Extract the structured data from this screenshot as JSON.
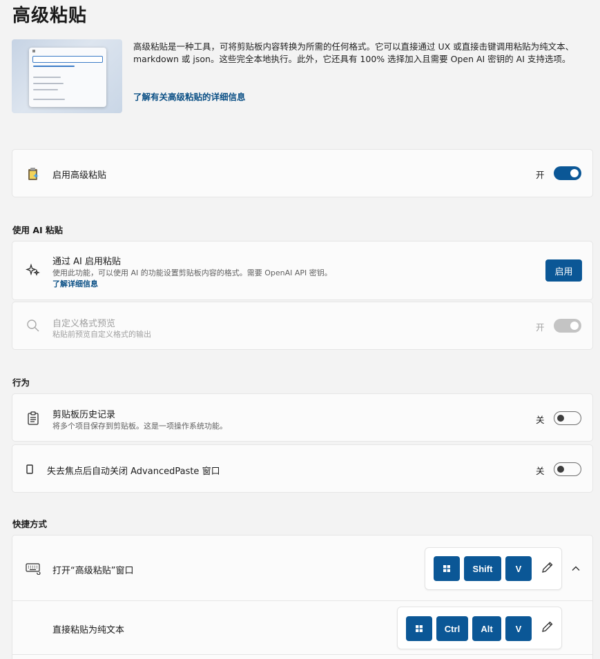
{
  "page": {
    "title": "高级粘贴",
    "description": "高级粘贴是一种工具，可将剪贴板内容转换为所需的任何格式。它可以直接通过 UX 或直接击键调用粘贴为纯文本、markdown 或 json。这些完全本地执行。此外，它还具有 100% 选择加入且需要 Open AI 密钥的 AI 支持选项。",
    "learn_more_link": "了解有关高级粘贴的详细信息"
  },
  "hero_mock": {
    "search_placeholder": "Describe a format (e.g. using AI)",
    "items": [
      "Paste as plain text",
      "Paste as markdown",
      "Paste as JSON",
      "Clipboard history"
    ]
  },
  "enable_card": {
    "icon": "advanced-paste-app-icon",
    "title": "启用高级粘贴",
    "state_label": "开",
    "enabled": true
  },
  "ai_section": {
    "header": "使用 AI 粘贴",
    "ai_paste": {
      "icon": "sparkle-icon",
      "title": "通过 AI 启用粘贴",
      "description": "使用此功能，可以使用 AI 的功能设置剪贴板内容的格式。需要 OpenAI API 密钥。",
      "link": "了解详细信息",
      "button": "启用"
    },
    "custom_preview": {
      "icon": "search-icon",
      "title": "自定义格式预览",
      "description": "粘贴前预览自定义格式的输出",
      "state_label": "开",
      "enabled": true,
      "disabled": true
    }
  },
  "behavior_section": {
    "header": "行为",
    "clipboard_history": {
      "icon": "clipboard-icon",
      "title": "剪贴板历史记录",
      "description": "将多个项目保存到剪贴板。这是一项操作系统功能。",
      "state_label": "关",
      "enabled": false
    },
    "auto_close": {
      "icon": "window-icon",
      "title": "失去焦点后自动关闭 AdvancedPaste 窗口",
      "state_label": "关",
      "enabled": false
    }
  },
  "shortcut_section": {
    "header": "快捷方式",
    "open_window": {
      "icon": "keyboard-icon",
      "title": "打开“高级粘贴”窗口",
      "keys": [
        "win",
        "Shift",
        "V"
      ]
    },
    "paste_plain": {
      "title": "直接粘贴为纯文本",
      "keys": [
        "win",
        "Ctrl",
        "Alt",
        "V"
      ]
    }
  },
  "colors": {
    "accent": "#0b5796",
    "link": "#0a4f85",
    "background": "#f3f3f3",
    "card": "#fbfbfb"
  }
}
